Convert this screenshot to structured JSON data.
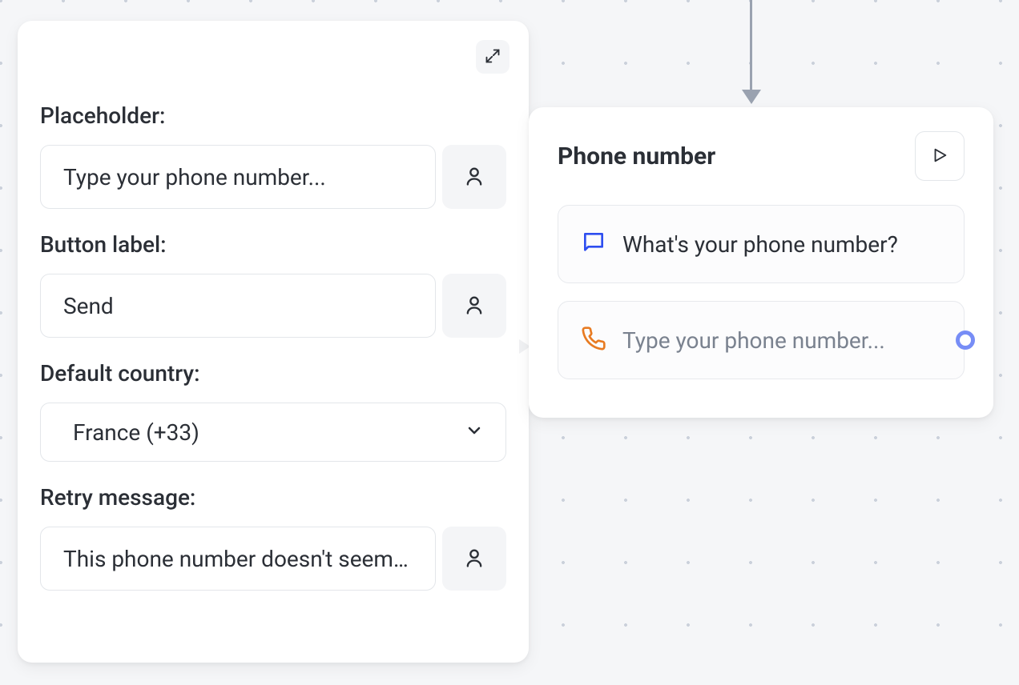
{
  "config_panel": {
    "placeholder_label": "Placeholder:",
    "placeholder_value": "Type your phone number...",
    "button_label_label": "Button label:",
    "button_label_value": "Send",
    "default_country_label": "Default country:",
    "default_country_value": "France (+33)",
    "retry_message_label": "Retry message:",
    "retry_message_value": "This phone number doesn't seem valid"
  },
  "node": {
    "title": "Phone number",
    "question_text": "What's your phone number?",
    "input_placeholder": "Type your phone number..."
  },
  "colors": {
    "chat_icon": "#2e4ef0",
    "phone_icon": "#e87b22",
    "handle": "#778df6"
  }
}
